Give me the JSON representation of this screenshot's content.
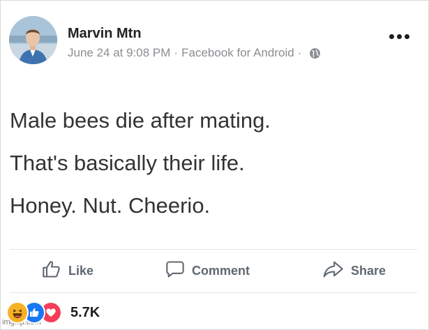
{
  "post": {
    "author": "Marvin Mtn",
    "date": "June 24 at 9:08 PM",
    "separator": "·",
    "source": "Facebook for Android",
    "audience_icon": "globe-icon",
    "lines": [
      "Male bees die after mating.",
      "That's basically their life.",
      "Honey. Nut. Cheerio."
    ]
  },
  "actions": {
    "like": "Like",
    "comment": "Comment",
    "share": "Share"
  },
  "reactions": {
    "icons": [
      "haha-icon",
      "like-icon",
      "love-icon"
    ],
    "count": "5.7K"
  },
  "watermark": "imgflip.com",
  "colors": {
    "like_blue": "#1877f2",
    "love_red": "#f33e58",
    "haha_yellow": "#f7b125",
    "muted_text": "#8a8d91"
  }
}
